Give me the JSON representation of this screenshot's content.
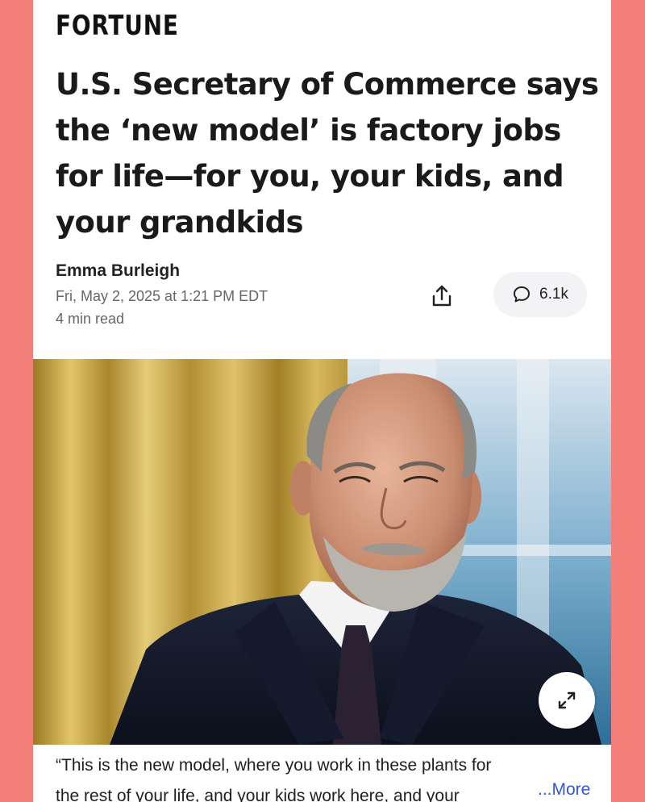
{
  "brand": {
    "name": "FORTUNE"
  },
  "article": {
    "headline": "U.S. Secretary of Commerce says the ‘new model’ is factory jobs for life—for you, your kids, and your grandkids",
    "author": "Emma Burleigh",
    "date": "Fri, May 2, 2025 at 1:21 PM EDT",
    "read_time": "4 min read",
    "caption_line1": "“This is the new model, where you work in these plants for",
    "caption_line2": "the rest of your life, and your kids work here, and your",
    "more_label": "...More"
  },
  "actions": {
    "share_icon": "share-icon",
    "comment_icon": "comment-icon",
    "comment_count": "6.1k",
    "expand_icon": "expand-icon"
  },
  "colors": {
    "background_frame": "#f27f7a",
    "link": "#3455db",
    "pill": "#f3f3f5"
  }
}
